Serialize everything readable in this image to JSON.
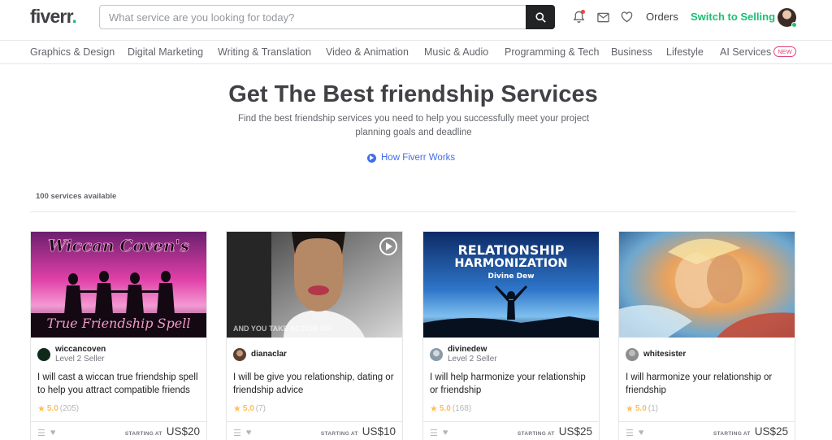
{
  "header": {
    "logo": "fiverr",
    "logo_dot": ".",
    "search_placeholder": "What service are you looking for today?",
    "orders": "Orders",
    "switch": "Switch to Selling"
  },
  "categories": [
    "Graphics & Design",
    "Digital Marketing",
    "Writing & Translation",
    "Video & Animation",
    "Music & Audio",
    "Programming & Tech",
    "Business",
    "Lifestyle",
    "AI Services"
  ],
  "new_badge": "NEW",
  "hero": {
    "title": "Get The Best friendship Services",
    "subtitle": "Find the best friendship services you need to help you successfully meet your project planning goals and deadline",
    "how": "How Fiverr Works"
  },
  "count": "100 services available",
  "starting_at": "STARTING AT",
  "gigs": [
    {
      "seller": "wiccancoven",
      "level": "Level 2 Seller",
      "title": "I will cast a wiccan true friendship spell to help you attract compatible friends",
      "rating": "5.0",
      "reviews": "(205)",
      "price": "US$20",
      "thumb_top": "Wiccan Coven's",
      "thumb_bottom": "True Friendship Spell"
    },
    {
      "seller": "dianaclar",
      "level": "",
      "title": "I will be give you relationship, dating or friendship advice",
      "rating": "5.0",
      "reviews": "(7)",
      "price": "US$10",
      "thumb_text": "AND YOU TAKE ACTION ON"
    },
    {
      "seller": "divinedew",
      "level": "Level 2 Seller",
      "title": "I will help harmonize your relationship or friendship",
      "rating": "5.0",
      "reviews": "(168)",
      "price": "US$25",
      "thumb_line1": "RELATIONSHIP",
      "thumb_line2": "HARMONIZATION",
      "thumb_line3": "Divine Dew"
    },
    {
      "seller": "whitesister",
      "level": "",
      "title": "I will harmonize your relationship or friendship",
      "rating": "5.0",
      "reviews": "(1)",
      "price": "US$25"
    }
  ]
}
